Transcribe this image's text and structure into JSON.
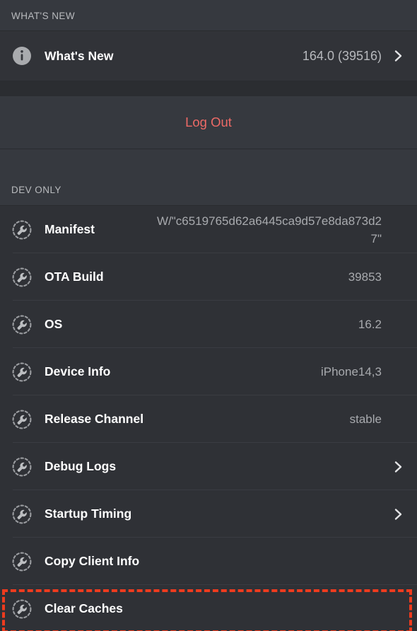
{
  "sections": {
    "whats_new": {
      "header": "WHAT'S NEW",
      "row": {
        "icon": "info-circle-icon",
        "label": "What's New",
        "value": "164.0 (39516)",
        "accessory": "chevron-right-icon"
      }
    },
    "logout": {
      "label": "Log Out",
      "color": "#ed6a66"
    },
    "dev_only": {
      "header": "DEV ONLY",
      "rows": [
        {
          "icon": "wrench-circle-icon",
          "label": "Manifest",
          "value": "W/\"c6519765d62a6445ca9d57e8da873d27\"",
          "accessory": ""
        },
        {
          "icon": "wrench-circle-icon",
          "label": "OTA Build",
          "value": "39853",
          "accessory": ""
        },
        {
          "icon": "wrench-circle-icon",
          "label": "OS",
          "value": "16.2",
          "accessory": ""
        },
        {
          "icon": "wrench-circle-icon",
          "label": "Device Info",
          "value": "iPhone14,3",
          "accessory": ""
        },
        {
          "icon": "wrench-circle-icon",
          "label": "Release Channel",
          "value": "stable",
          "accessory": ""
        },
        {
          "icon": "wrench-circle-icon",
          "label": "Debug Logs",
          "value": "",
          "accessory": "chevron-right-icon"
        },
        {
          "icon": "wrench-circle-icon",
          "label": "Startup Timing",
          "value": "",
          "accessory": "chevron-right-icon"
        },
        {
          "icon": "wrench-circle-icon",
          "label": "Copy Client Info",
          "value": "",
          "accessory": ""
        },
        {
          "icon": "wrench-circle-icon",
          "label": "Clear Caches",
          "value": "",
          "accessory": ""
        }
      ]
    }
  },
  "highlight": {
    "target": "Clear Caches",
    "color": "#ef3b1e"
  },
  "theme": {
    "background": "#2f3136",
    "header_background": "#36393f",
    "row_background": "#2f3136",
    "label_color": "#ffffff",
    "value_color": "#a8aaae",
    "divider_color": "#3a3c42"
  }
}
